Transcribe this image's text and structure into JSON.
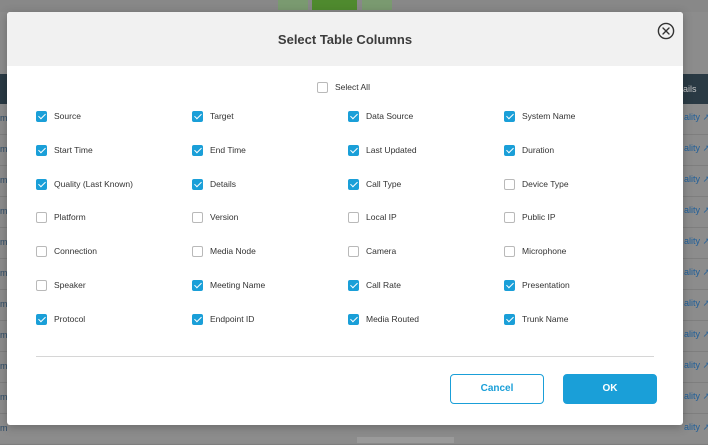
{
  "background": {
    "header_label": "ails",
    "rows": [
      {
        "left": "m",
        "link": "ality"
      },
      {
        "left": "m",
        "link": "ality"
      },
      {
        "left": "m",
        "link": "ality"
      },
      {
        "left": "m",
        "link": "ality"
      },
      {
        "left": "m",
        "link": "ality"
      },
      {
        "left": "m",
        "link": "ality"
      },
      {
        "left": "m",
        "link": "ality"
      },
      {
        "left": "m",
        "link": "ality"
      },
      {
        "left": "m",
        "link": "ality"
      },
      {
        "left": "m",
        "link": "ality"
      },
      {
        "left": "m",
        "link": "ality"
      }
    ]
  },
  "dialog": {
    "title": "Select Table Columns",
    "close_icon": "close-circle-icon",
    "select_all": {
      "label": "Select All",
      "checked": false
    },
    "columns": [
      {
        "label": "Source",
        "checked": true
      },
      {
        "label": "Target",
        "checked": true
      },
      {
        "label": "Data Source",
        "checked": true
      },
      {
        "label": "System Name",
        "checked": true
      },
      {
        "label": "Start Time",
        "checked": true
      },
      {
        "label": "End Time",
        "checked": true
      },
      {
        "label": "Last Updated",
        "checked": true
      },
      {
        "label": "Duration",
        "checked": true
      },
      {
        "label": "Quality (Last Known)",
        "checked": true
      },
      {
        "label": "Details",
        "checked": true
      },
      {
        "label": "Call Type",
        "checked": true
      },
      {
        "label": "Device Type",
        "checked": false
      },
      {
        "label": "Platform",
        "checked": false
      },
      {
        "label": "Version",
        "checked": false
      },
      {
        "label": "Local IP",
        "checked": false
      },
      {
        "label": " Public IP",
        "checked": false
      },
      {
        "label": "Connection",
        "checked": false
      },
      {
        "label": "Media Node",
        "checked": false
      },
      {
        "label": "Camera",
        "checked": false
      },
      {
        "label": "Microphone",
        "checked": false
      },
      {
        "label": "Speaker",
        "checked": false
      },
      {
        "label": "Meeting Name",
        "checked": true
      },
      {
        "label": "Call Rate",
        "checked": true
      },
      {
        "label": "Presentation",
        "checked": true
      },
      {
        "label": "Protocol",
        "checked": true
      },
      {
        "label": "Endpoint ID",
        "checked": true
      },
      {
        "label": "Media Routed",
        "checked": true
      },
      {
        "label": "Trunk Name",
        "checked": true
      }
    ],
    "cancel_label": "Cancel",
    "ok_label": "OK",
    "colors": {
      "accent": "#1a9fd8",
      "header_bg": "#f1f1f1",
      "overlay": "#8c8c8c"
    }
  }
}
